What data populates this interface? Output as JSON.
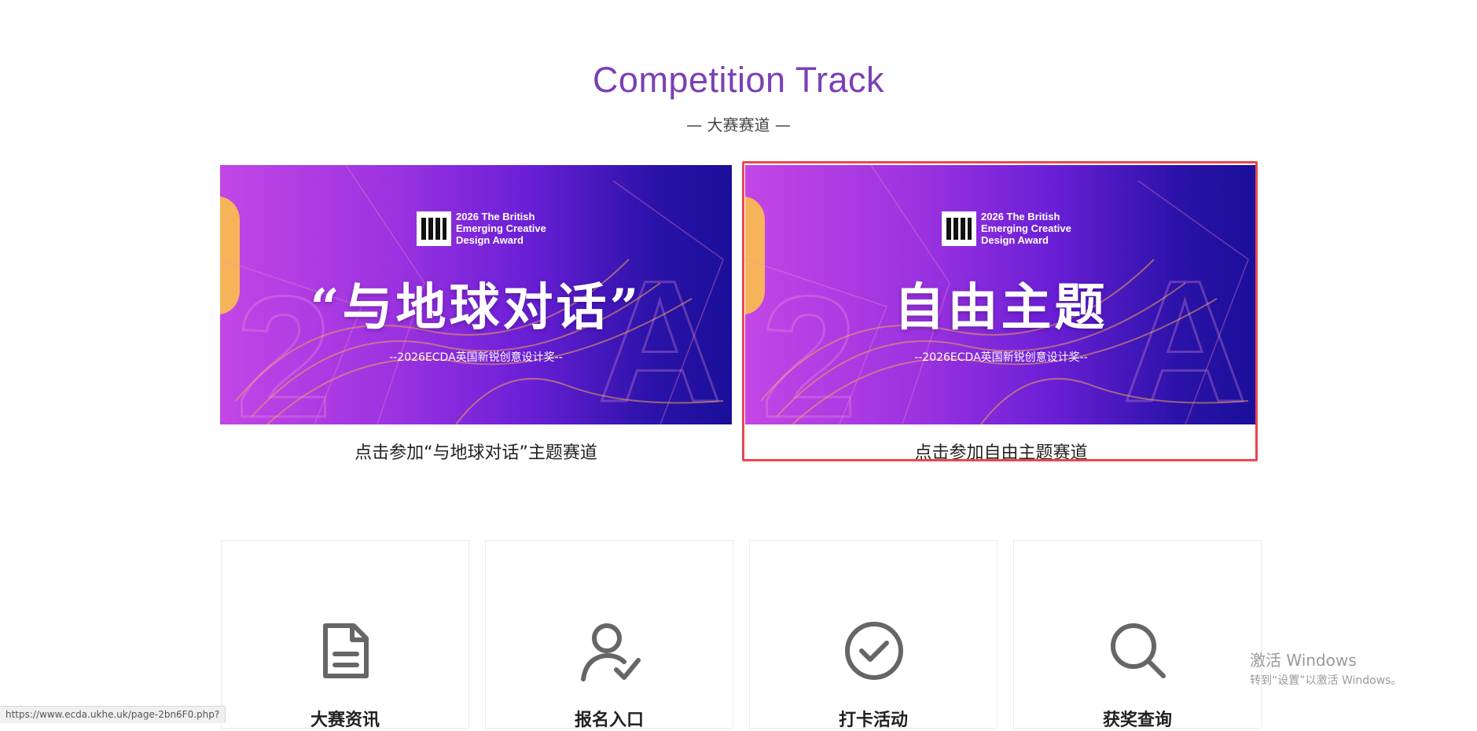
{
  "section": {
    "title": "Competition Track",
    "subtitle": "— 大赛赛道 —"
  },
  "tracks": [
    {
      "banner_logo": "2026   The British\nEmerging Creative\nDesign Award",
      "banner_title": "“与地球对话”",
      "banner_subtitle": "--2026ECDA英国新锐创意设计奖--",
      "caption": "点击参加“与地球对话”主题赛道"
    },
    {
      "banner_logo": "2026   The British\nEmerging Creative\nDesign Award",
      "banner_title": "自由主题",
      "banner_subtitle": "--2026ECDA英国新锐创意设计奖--",
      "caption": "点击参加自由主题赛道"
    }
  ],
  "features": [
    {
      "label": "大赛资讯",
      "icon": "document-icon"
    },
    {
      "label": "报名入口",
      "icon": "user-check-icon"
    },
    {
      "label": "打卡活动",
      "icon": "check-circle-icon"
    },
    {
      "label": "获奖查询",
      "icon": "search-icon"
    }
  ],
  "status_bar": {
    "url": "https://www.ecda.ukhe.uk/page-2bn6F0.php?"
  },
  "windows_watermark": {
    "line1": "激活 Windows",
    "line2": "转到“设置”以激活 Windows。"
  },
  "colors": {
    "title": "#7b3fb6",
    "highlight_border": "#e8484e",
    "banner_gradient": [
      "#c346e6",
      "#9a32e0",
      "#6a1fd6",
      "#1a0f9a"
    ],
    "icon": "#666666"
  }
}
